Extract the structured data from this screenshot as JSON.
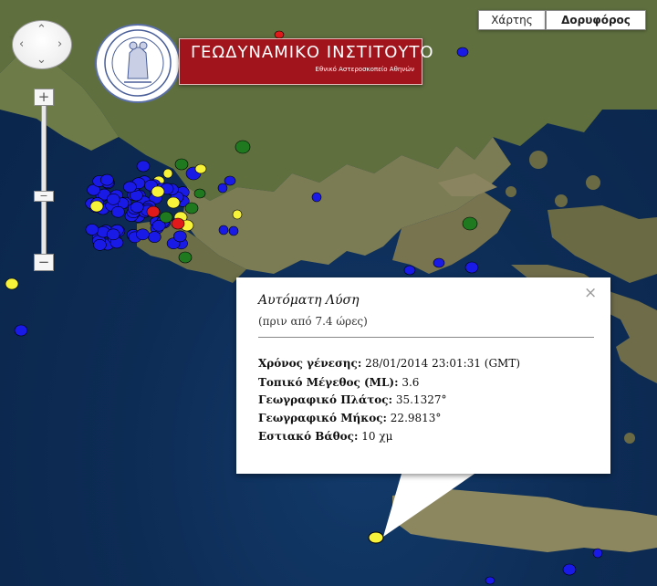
{
  "map_type": {
    "map_label": "Χάρτης",
    "satellite_label": "Δορυφόρος",
    "selected": "Δορυφόρος"
  },
  "zoom": {
    "in_label": "+",
    "out_label": "−"
  },
  "header": {
    "title": "ΓΕΩΔΥΝΑΜΙΚΟ ΙΝΣΤΙΤΟΥΤΟ",
    "subtitle": "Εθνικό Αστεροσκοπείο Αθηνών"
  },
  "popup": {
    "title": "Αυτόματη Λύση",
    "subtitle": "(πριν από 7.4 ώρες)",
    "close_label": "×",
    "fields": [
      {
        "label": "Χρόνος γένεσης:",
        "value": "28/01/2014  23:01:31 (GMT)"
      },
      {
        "label": "Τοπικό Μέγεθος (ML):",
        "value": "3.6"
      },
      {
        "label": "Γεωγραφικό Πλάτος:",
        "value": "35.1327°"
      },
      {
        "label": "Γεωγραφικό Μήκος:",
        "value": "22.9813°"
      },
      {
        "label": "Εστιακό Βάθος:",
        "value": "10 χμ"
      }
    ]
  },
  "legend_colors": {
    "blue": "#1a1ae6",
    "yellow": "#f7f23a",
    "green": "#1f7a1f",
    "red": "#e01a1a"
  },
  "earthquakes": [
    {
      "lat": 35.1327,
      "lon": 22.9813,
      "color": "yellow",
      "selected": true
    }
  ]
}
